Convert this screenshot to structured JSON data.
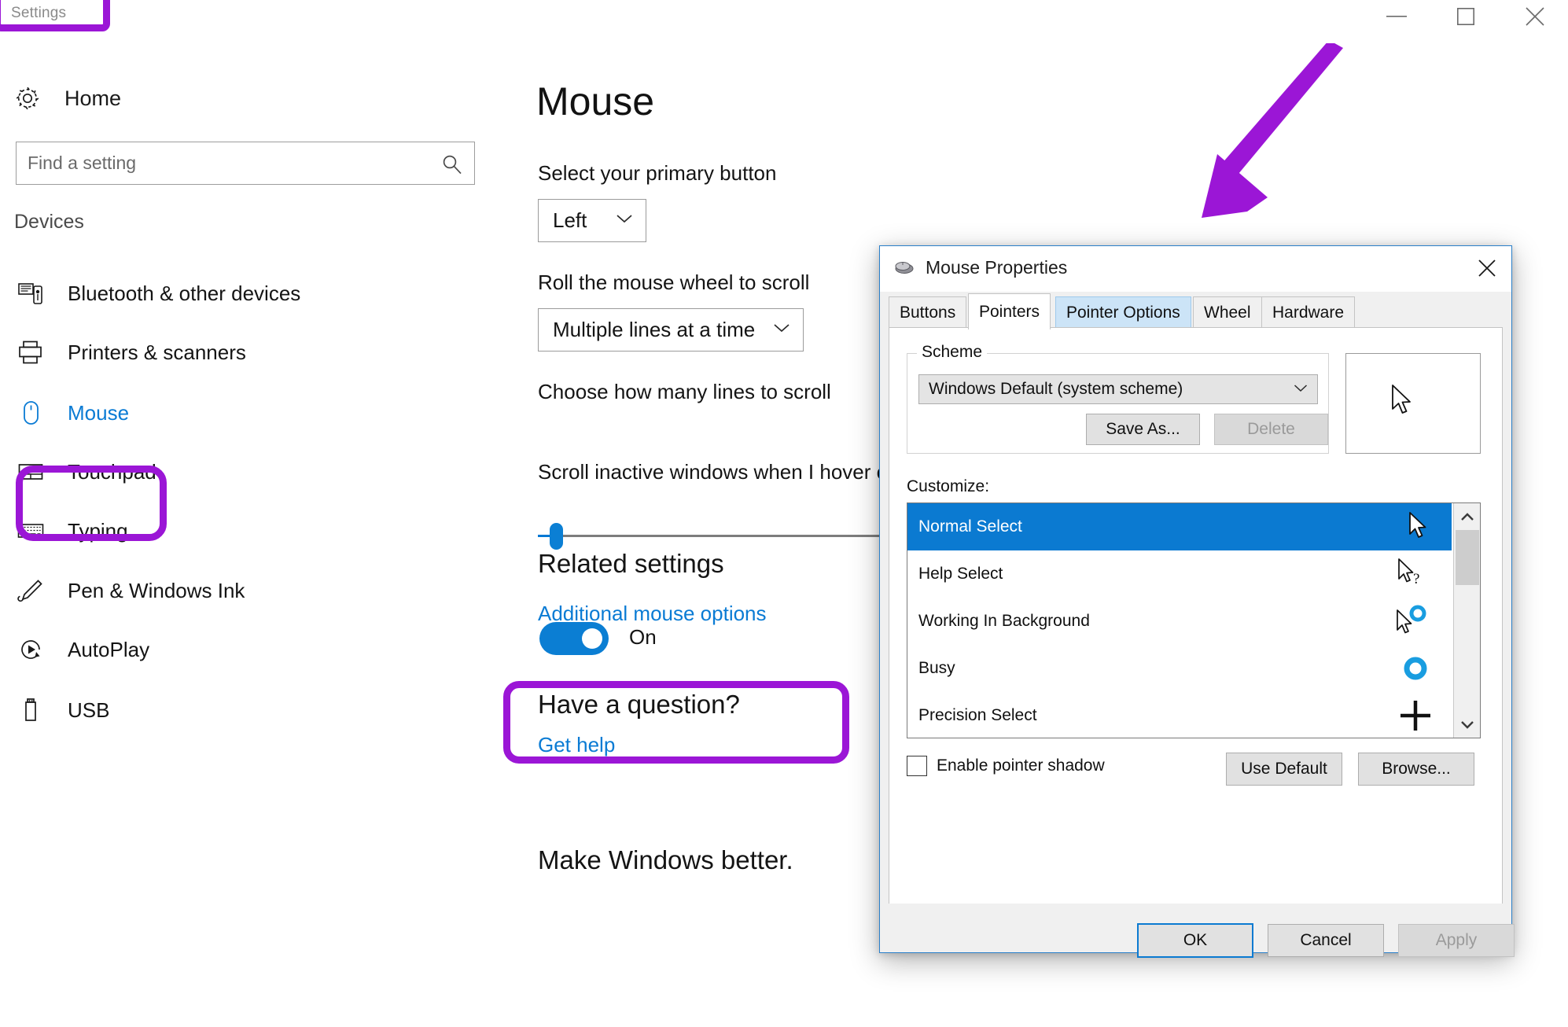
{
  "window": {
    "title": "Settings",
    "controls": {
      "minimize": "minimize-button",
      "maximize": "maximize-button",
      "close": "close-button"
    }
  },
  "sidebar": {
    "home_label": "Home",
    "search": {
      "placeholder": "Find a setting",
      "value": ""
    },
    "group_header": "Devices",
    "items": [
      {
        "label": "Bluetooth & other devices",
        "icon": "bluetooth-devices-icon",
        "active": false
      },
      {
        "label": "Printers & scanners",
        "icon": "printer-icon",
        "active": false
      },
      {
        "label": "Mouse",
        "icon": "mouse-icon",
        "active": true
      },
      {
        "label": "Touchpad",
        "icon": "touchpad-icon",
        "active": false
      },
      {
        "label": "Typing",
        "icon": "keyboard-icon",
        "active": false
      },
      {
        "label": "Pen & Windows Ink",
        "icon": "pen-icon",
        "active": false
      },
      {
        "label": "AutoPlay",
        "icon": "autoplay-icon",
        "active": false
      },
      {
        "label": "USB",
        "icon": "usb-icon",
        "active": false
      }
    ]
  },
  "main": {
    "page_title": "Mouse",
    "primary_button": {
      "label": "Select your primary button",
      "value": "Left"
    },
    "wheel_scroll": {
      "label": "Roll the mouse wheel to scroll",
      "value": "Multiple lines at a time"
    },
    "lines_to_scroll": {
      "label": "Choose how many lines to scroll"
    },
    "scroll_inactive": {
      "label": "Scroll inactive windows when I hover over them",
      "state": "On"
    },
    "related_settings": {
      "heading": "Related settings",
      "link": "Additional mouse options"
    },
    "question": {
      "heading": "Have a question?",
      "link": "Get help"
    },
    "feedback": {
      "heading": "Make Windows better."
    }
  },
  "dialog": {
    "title": "Mouse Properties",
    "icon": "mouse-icon",
    "close_label": "close-dialog",
    "tabs": [
      {
        "label": "Buttons",
        "state": "normal"
      },
      {
        "label": "Pointers",
        "state": "selected"
      },
      {
        "label": "Pointer Options",
        "state": "hover"
      },
      {
        "label": "Wheel",
        "state": "normal"
      },
      {
        "label": "Hardware",
        "state": "normal"
      }
    ],
    "scheme": {
      "legend": "Scheme",
      "value": "Windows Default (system scheme)",
      "save_as": "Save As...",
      "delete": "Delete"
    },
    "customize": {
      "label": "Customize:",
      "rows": [
        {
          "name": "Normal Select",
          "cursor": "arrow-cursor",
          "selected": true
        },
        {
          "name": "Help Select",
          "cursor": "arrow-question-cursor",
          "selected": false
        },
        {
          "name": "Working In Background",
          "cursor": "arrow-ring-cursor",
          "selected": false
        },
        {
          "name": "Busy",
          "cursor": "ring-cursor",
          "selected": false
        },
        {
          "name": "Precision Select",
          "cursor": "crosshair-cursor",
          "selected": false
        }
      ]
    },
    "enable_shadow": {
      "label": "Enable pointer shadow",
      "checked": false
    },
    "use_default": "Use Default",
    "browse": "Browse...",
    "ok": "OK",
    "cancel": "Cancel",
    "apply": "Apply"
  },
  "annotations": {
    "highlight_color": "#9b16d6",
    "arrow_color": "#9b16d6",
    "highlights": [
      "Settings",
      "Mouse",
      "Additional mouse options"
    ],
    "arrow_points_to": "Mouse Properties"
  },
  "colors": {
    "accent": "#0078d4",
    "link": "#0a7bd4",
    "selection": "#0b7ad1",
    "annotation": "#9b16d6"
  }
}
